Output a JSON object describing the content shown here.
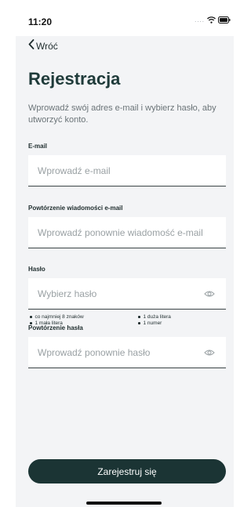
{
  "status_bar": {
    "time": "11:20",
    "signal_dots": "....",
    "icons": [
      "wifi-icon",
      "battery-icon"
    ]
  },
  "nav": {
    "back_label": "Wróć",
    "back_icon": "chevron-left-icon"
  },
  "header": {
    "title": "Rejestracja",
    "intro": "Wprowadź swój adres e-mail i wybierz hasło, aby utworzyć konto."
  },
  "form": {
    "email": {
      "label": "E-mail",
      "placeholder": "Wprowadź e-mail",
      "value": ""
    },
    "email_confirm": {
      "label": "Powtórzenie wiadomości e-mail",
      "placeholder": "Wprowadź ponownie wiadomość e-mail",
      "value": ""
    },
    "password": {
      "label": "Hasło",
      "placeholder": "Wybierz hasło",
      "value": "",
      "icon": "eye-icon",
      "requirements": [
        "co najmniej 8 znaków",
        "1 duża litera",
        "1 mała litera",
        "1 numer"
      ]
    },
    "password_confirm": {
      "label": "Powtórzenie hasła",
      "placeholder": "Wprowadź ponownie hasło",
      "value": "",
      "icon": "eye-icon"
    },
    "submit_label": "Zarejestruj się"
  },
  "colors": {
    "background": "#f3f4f6",
    "primary_button": "#1b3434",
    "title": "#1f3b3a",
    "muted_text": "#6b7478",
    "field_border": "#3b4446"
  }
}
